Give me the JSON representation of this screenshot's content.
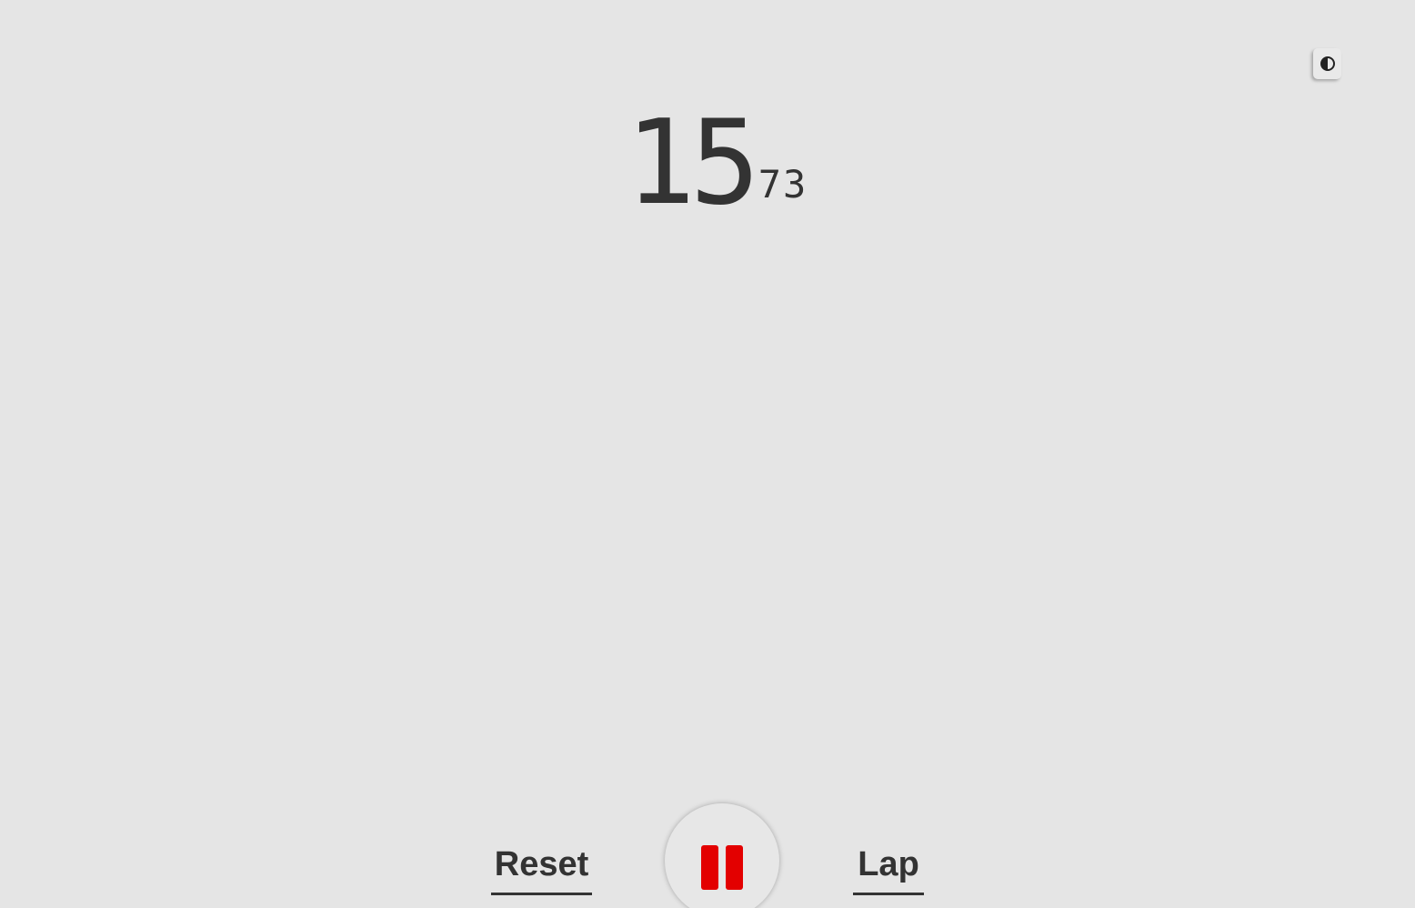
{
  "header": {
    "theme_toggle_icon": "half-circle-contrast-icon"
  },
  "timer": {
    "seconds": "15",
    "fraction": "73"
  },
  "controls": {
    "reset_label": "Reset",
    "lap_label": "Lap",
    "play_pause_icon": "pause-icon",
    "pause_color": "#e30000"
  },
  "colors": {
    "background": "#e5e5e5",
    "text": "#333333"
  }
}
